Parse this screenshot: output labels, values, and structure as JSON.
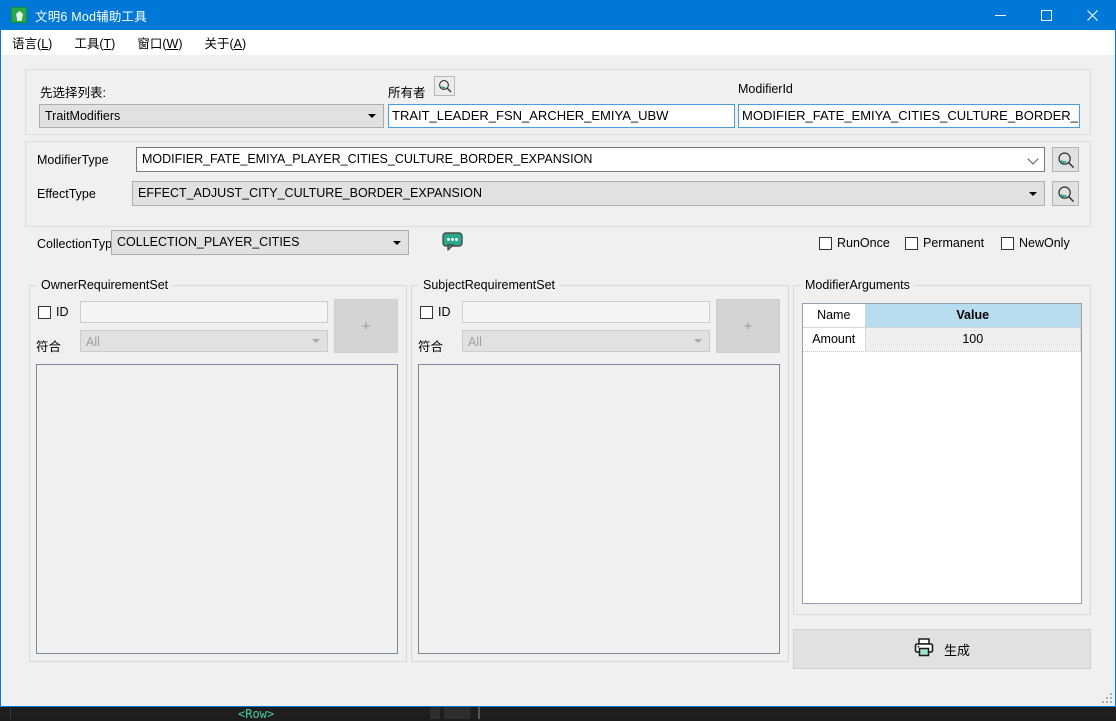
{
  "window": {
    "title": "文明6 Mod辅助工具",
    "icon": "app-icon",
    "controls": {
      "minimize": "minimize-icon",
      "maximize": "maximize-icon",
      "close": "close-icon"
    }
  },
  "menubar": {
    "items": [
      {
        "label": "语言",
        "accel": "L"
      },
      {
        "label": "工具",
        "accel": "T"
      },
      {
        "label": "窗口",
        "accel": "W"
      },
      {
        "label": "关于",
        "accel": "A"
      }
    ]
  },
  "top_panel": {
    "list_label": "先选择列表:",
    "list_value": "TraitModifiers",
    "owner_label": "所有者",
    "owner_search_icon": "search-icon",
    "owner_value": "TRAIT_LEADER_FSN_ARCHER_EMIYA_UBW",
    "modifier_id_label": "ModifierId",
    "modifier_id_value": "MODIFIER_FATE_EMIYA_CITIES_CULTURE_BORDER_EXPANSION"
  },
  "type_panel": {
    "modifier_type_label": "ModifierType",
    "modifier_type_value": "MODIFIER_FATE_EMIYA_PLAYER_CITIES_CULTURE_BORDER_EXPANSION",
    "modifier_type_search_icon": "search-icon",
    "effect_type_label": "EffectType",
    "effect_type_value": "EFFECT_ADJUST_CITY_CULTURE_BORDER_EXPANSION",
    "effect_type_search_icon": "search-icon",
    "collection_type_label": "CollectionType",
    "collection_type_value": "COLLECTION_PLAYER_CITIES",
    "comment_icon": "comment-bubble-icon",
    "flags": [
      {
        "label": "RunOnce",
        "checked": false
      },
      {
        "label": "Permanent",
        "checked": false
      },
      {
        "label": "NewOnly",
        "checked": false
      }
    ]
  },
  "owner_requirement_set": {
    "title": "OwnerRequirementSet",
    "id_label": "ID",
    "id_checked": false,
    "id_value": "",
    "match_label": "符合",
    "match_value": "All",
    "add_label": "+",
    "list_items": []
  },
  "subject_requirement_set": {
    "title": "SubjectRequirementSet",
    "id_label": "ID",
    "id_checked": false,
    "id_value": "",
    "match_label": "符合",
    "match_value": "All",
    "add_label": "+",
    "list_items": []
  },
  "modifier_arguments": {
    "title": "ModifierArguments",
    "columns": [
      {
        "key": "name",
        "label": "Name",
        "selected": false
      },
      {
        "key": "value",
        "label": "Value",
        "selected": true
      }
    ],
    "rows": [
      {
        "name": "Amount",
        "value": "100"
      }
    ]
  },
  "generate_button": {
    "label": "生成",
    "icon": "printer-icon"
  },
  "backdrop": {
    "code_fragment": "<Row>"
  },
  "colors": {
    "titlebar": "#0078d7",
    "window_bg": "#f0f0f0",
    "focus_border": "#4a9ee0",
    "grid_header_selected": "#b8dcf0",
    "accent_icon": "#2aa88b",
    "code_green": "#4ec9a0"
  }
}
